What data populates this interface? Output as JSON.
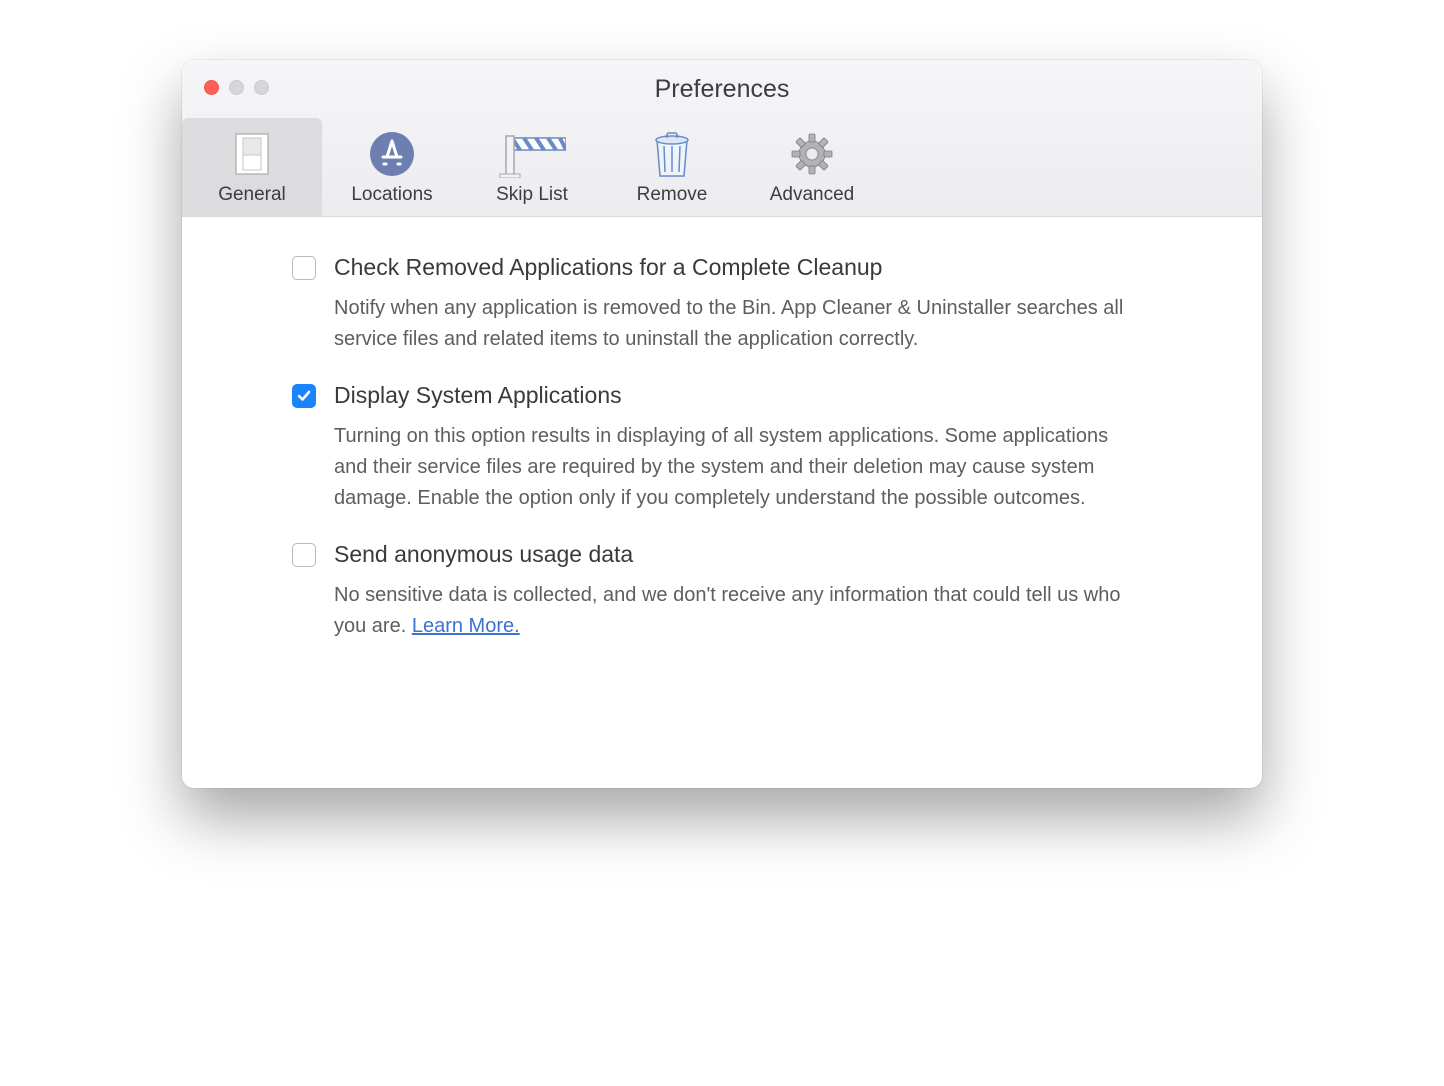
{
  "window": {
    "title": "Preferences"
  },
  "toolbar": {
    "items": [
      {
        "label": "General"
      },
      {
        "label": "Locations"
      },
      {
        "label": "Skip List"
      },
      {
        "label": "Remove"
      },
      {
        "label": "Advanced"
      }
    ]
  },
  "prefs": [
    {
      "checked": false,
      "title": "Check Removed Applications for a Complete Cleanup",
      "desc": "Notify when any application is removed to the Bin. App Cleaner & Uninstaller searches all service files and related items to uninstall the application correctly."
    },
    {
      "checked": true,
      "title": "Display System Applications",
      "desc": "Turning on this option results in displaying of all system applications. Some applications and their service files are required by the system and their deletion may cause system damage. Enable the option only if you completely understand the possible outcomes."
    },
    {
      "checked": false,
      "title": "Send anonymous usage data",
      "desc_prefix": "No sensitive data is collected, and we don't receive any information that could tell us who you are.   ",
      "link": "Learn More."
    }
  ]
}
